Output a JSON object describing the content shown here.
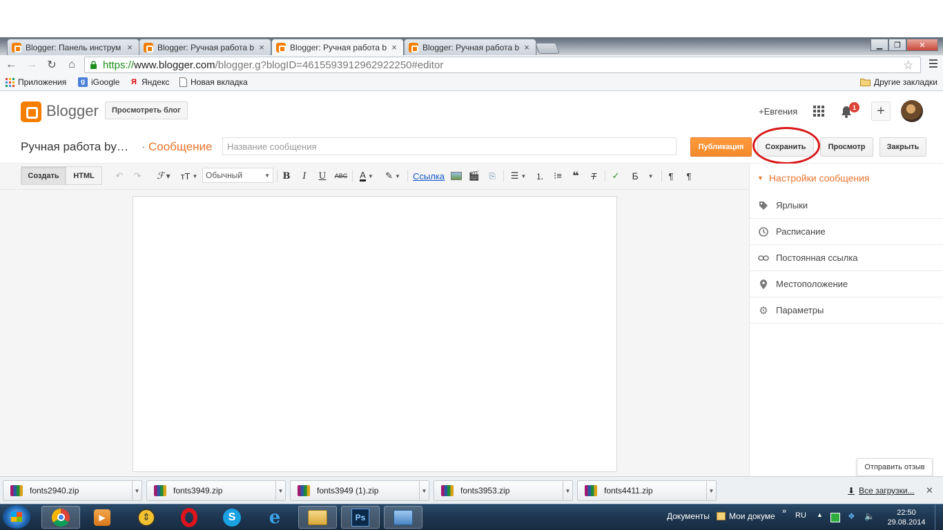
{
  "browser": {
    "tabs": [
      {
        "label": "Blogger: Панель инструм",
        "active": false
      },
      {
        "label": "Blogger: Ручная работа b",
        "active": false
      },
      {
        "label": "Blogger: Ручная работа b",
        "active": true
      },
      {
        "label": "Blogger: Ручная работа b",
        "active": false
      }
    ],
    "tab_close": "×",
    "url": {
      "scheme": "https://",
      "host": "www.blogger.com",
      "rest": "/blogger.g?blogID=4615593912962922250#editor"
    },
    "bookmarks": [
      {
        "label": "Приложения",
        "icon": "apps-grid-icon"
      },
      {
        "label": "iGoogle",
        "icon": "google-icon"
      },
      {
        "label": "Яндекс",
        "icon": "yandex-icon"
      },
      {
        "label": "Новая вкладка",
        "icon": "page-icon"
      }
    ],
    "other_bookmarks": "Другие закладки"
  },
  "blogger": {
    "brand": "Blogger",
    "view_blog": "Просмотреть блог",
    "user": "+Евгения",
    "notifications": "1",
    "accent_color": "#f57d00"
  },
  "post": {
    "blog_title": "Ручная работа by…",
    "separator": "·",
    "type": "Сообщение",
    "title_placeholder": "Название сообщения",
    "publish": "Публикация",
    "save": "Сохранить",
    "preview": "Просмотр",
    "close": "Закрыть"
  },
  "editor": {
    "mode_compose": "Создать",
    "mode_html": "HTML",
    "format_select": "Обычный",
    "link": "Ссылка",
    "cyr_b": "Б"
  },
  "sidebar": {
    "header": "Настройки сообщения",
    "items": [
      {
        "label": "Ярлыки",
        "icon": "tag-icon"
      },
      {
        "label": "Расписание",
        "icon": "clock-icon"
      },
      {
        "label": "Постоянная ссылка",
        "icon": "link-icon"
      },
      {
        "label": "Местоположение",
        "icon": "location-pin-icon"
      },
      {
        "label": "Параметры",
        "icon": "gear-icon"
      }
    ],
    "feedback": "Отправить отзыв"
  },
  "downloads": {
    "items": [
      "fonts2940.zip",
      "fonts3949.zip",
      "fonts3949 (1).zip",
      "fonts3953.zip",
      "fonts4411.zip"
    ],
    "show_all": "Все загрузки..."
  },
  "taskbar": {
    "docs_label": "Документы",
    "docs_window": "Мои докуме",
    "lang": "RU",
    "time": "22:50",
    "date": "29.08.2014"
  }
}
